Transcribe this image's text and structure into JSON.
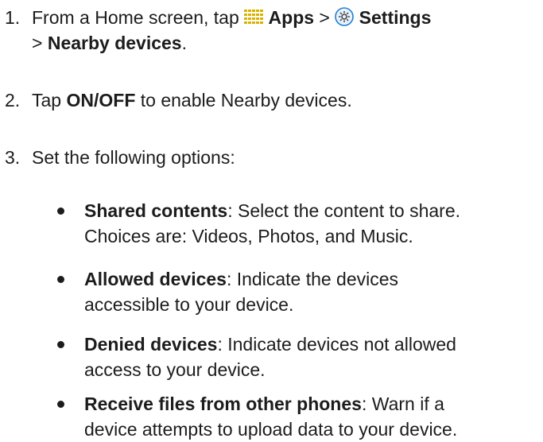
{
  "steps": [
    {
      "number": "1.",
      "line1_pre": "From a Home screen, tap ",
      "apps_label": "Apps",
      "sep1": " > ",
      "settings_label": "Settings",
      "line2_pre": "> ",
      "nearby_label": "Nearby devices",
      "line2_post": "."
    },
    {
      "number": "2.",
      "pre": "Tap ",
      "onoff_label": "ON/OFF",
      "post": " to enable Nearby devices."
    },
    {
      "number": "3.",
      "text": "Set the following options:"
    }
  ],
  "options": [
    {
      "term": "Shared contents",
      "line1": ": Select the content to share.",
      "line2": "Choices are: Videos, Photos, and Music."
    },
    {
      "term": "Allowed devices",
      "line1": ": Indicate the devices",
      "line2": "accessible to your device."
    },
    {
      "term": "Denied devices",
      "line1": ": Indicate devices not allowed",
      "line2": "access to your device."
    },
    {
      "term": "Receive files from other phones",
      "line1": ": Warn if a",
      "line2": "device attempts to upload data to your device."
    }
  ],
  "icons": {
    "apps": "apps-grid-icon",
    "settings": "settings-gear-icon"
  },
  "colors": {
    "text": "#1c1c1c",
    "apps_icon": "#d9b200",
    "settings_ring": "#1f7fd4"
  }
}
